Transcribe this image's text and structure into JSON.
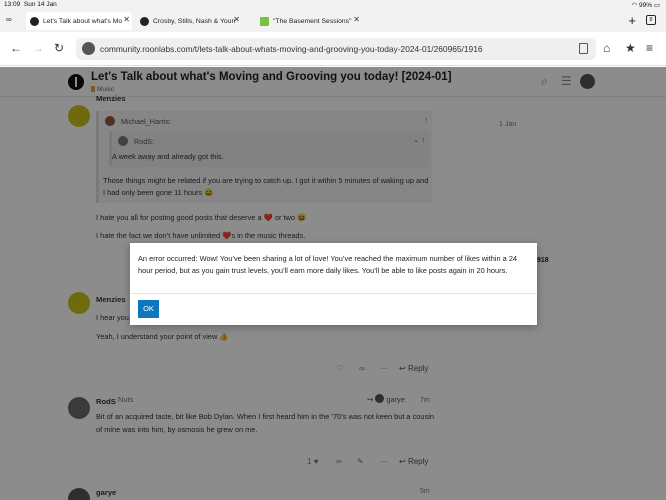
{
  "status_bar": {
    "time": "13:09",
    "date": "Sun 14 Jan",
    "battery": "99%"
  },
  "tabs": [
    {
      "label": "Let's Talk about what's Mo",
      "active": true
    },
    {
      "label": "Crosby, Stills, Nash & Youn",
      "active": false
    },
    {
      "label": "\"The Basement Sessions\"",
      "active": false
    }
  ],
  "tab_count": "8",
  "url": "community.roonlabs.com/t/lets-talk-about-whats-moving-and-grooving-you-today-2024-01/260965/1916",
  "topic": {
    "title": "Let's Talk about what's Moving and Grooving you today! [2024-01]",
    "category": "Music"
  },
  "posts": {
    "p1": {
      "author": "Menzies",
      "quote_author": "Michael_Harris:",
      "nested_author": "RodS:",
      "nested_text": "A week away and already got this.",
      "quote_line1": "Those things might be related if you are trying to catch up. I got it within 5 minutes of waking up and",
      "quote_line2": "I had only been gone 11 hours 😄",
      "line1": "I hate you all for posting good posts that deserve a ❤️ or two 😆",
      "line2": "I hate the fact we don’t have unlimited ❤️s in the music threads.",
      "date": "1 Jan"
    },
    "p2": {
      "author": "Menzies",
      "line1": "I hear you...",
      "line2": "Yeah, I understand your point of view 👍",
      "reply": "Reply"
    },
    "p3": {
      "author": "RodS",
      "subtitle": "Nuts",
      "reply_to": "garye",
      "time": "7m",
      "line1": "Bit of an acquired taste, bit like Bob Dylan. When I first heard him in the ’70’s was not keen but a cousin",
      "line2": "of mine was into him, by osmosis he grew on me.",
      "likes": "1",
      "reply": "Reply"
    },
    "p4": {
      "author": "garye",
      "time": "5m"
    }
  },
  "side_number": "918",
  "modal": {
    "message": "An error occurred: Wow! You’ve been sharing a lot of love! You’ve reached the maximum number of likes within a 24 hour period, but as you gain trust levels, you’ll earn more daily likes. You’ll be able to like posts again in 20 hours.",
    "ok_label": "OK"
  }
}
